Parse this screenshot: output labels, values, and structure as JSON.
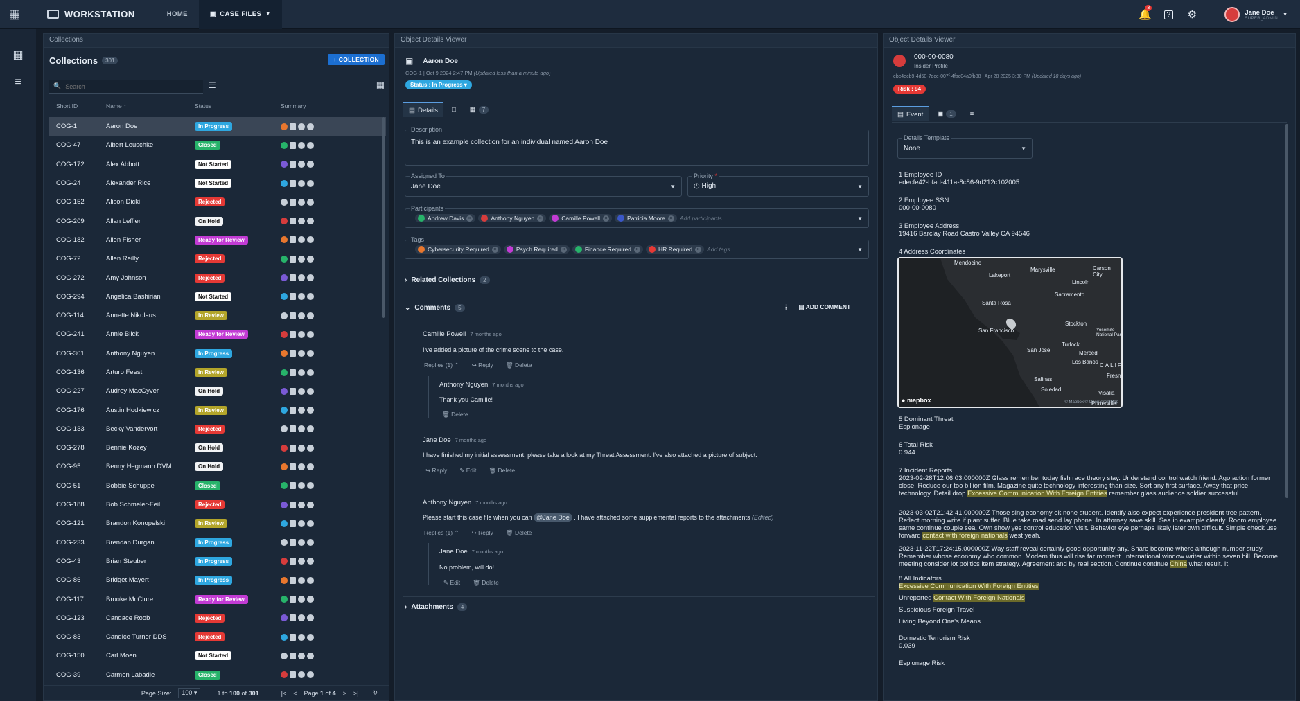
{
  "app": {
    "title": "WORKSTATION",
    "nav": [
      "HOME",
      "CASE FILES"
    ],
    "notif_count": "3",
    "user_name": "Jane Doe",
    "user_role": "SUPER_ADMIN"
  },
  "collections": {
    "panel_title": "Collections",
    "title": "Collections",
    "count": "301",
    "add_label": "COLLECTION",
    "search_placeholder": "Search",
    "columns": [
      "Short ID",
      "Name ↑",
      "Status",
      "Summary"
    ],
    "status_colors": {
      "In Progress": "#2ea7e0",
      "Closed": "#27b36a",
      "Not Started": "#ffffff",
      "Rejected": "#e53935",
      "On Hold": "#f1f3f5",
      "Ready for Review": "#c23bd4",
      "In Review": "#b3a52a"
    },
    "rows": [
      {
        "id": "COG-1",
        "name": "Aaron Doe",
        "status": "In Progress"
      },
      {
        "id": "COG-47",
        "name": "Albert Leuschke",
        "status": "Closed"
      },
      {
        "id": "COG-172",
        "name": "Alex Abbott",
        "status": "Not Started"
      },
      {
        "id": "COG-24",
        "name": "Alexander Rice",
        "status": "Not Started"
      },
      {
        "id": "COG-152",
        "name": "Alison Dicki",
        "status": "Rejected"
      },
      {
        "id": "COG-209",
        "name": "Allan Leffler",
        "status": "On Hold"
      },
      {
        "id": "COG-182",
        "name": "Allen Fisher",
        "status": "Ready for Review"
      },
      {
        "id": "COG-72",
        "name": "Allen Reilly",
        "status": "Rejected"
      },
      {
        "id": "COG-272",
        "name": "Amy Johnson",
        "status": "Rejected"
      },
      {
        "id": "COG-294",
        "name": "Angelica Bashirian",
        "status": "Not Started"
      },
      {
        "id": "COG-114",
        "name": "Annette Nikolaus",
        "status": "In Review"
      },
      {
        "id": "COG-241",
        "name": "Annie Blick",
        "status": "Ready for Review"
      },
      {
        "id": "COG-301",
        "name": "Anthony Nguyen",
        "status": "In Progress"
      },
      {
        "id": "COG-136",
        "name": "Arturo Feest",
        "status": "In Review"
      },
      {
        "id": "COG-227",
        "name": "Audrey MacGyver",
        "status": "On Hold"
      },
      {
        "id": "COG-176",
        "name": "Austin Hodkiewicz",
        "status": "In Review"
      },
      {
        "id": "COG-133",
        "name": "Becky Vandervort",
        "status": "Rejected"
      },
      {
        "id": "COG-278",
        "name": "Bennie Kozey",
        "status": "On Hold"
      },
      {
        "id": "COG-95",
        "name": "Benny Hegmann DVM",
        "status": "On Hold"
      },
      {
        "id": "COG-51",
        "name": "Bobbie Schuppe",
        "status": "Closed"
      },
      {
        "id": "COG-188",
        "name": "Bob Schmeler-Feil",
        "status": "Rejected"
      },
      {
        "id": "COG-121",
        "name": "Brandon Konopelski",
        "status": "In Review"
      },
      {
        "id": "COG-233",
        "name": "Brendan Durgan",
        "status": "In Progress"
      },
      {
        "id": "COG-43",
        "name": "Brian Steuber",
        "status": "In Progress"
      },
      {
        "id": "COG-86",
        "name": "Bridget Mayert",
        "status": "In Progress"
      },
      {
        "id": "COG-117",
        "name": "Brooke McClure",
        "status": "Ready for Review"
      },
      {
        "id": "COG-123",
        "name": "Candace Roob",
        "status": "Rejected"
      },
      {
        "id": "COG-83",
        "name": "Candice Turner DDS",
        "status": "Rejected"
      },
      {
        "id": "COG-150",
        "name": "Carl Moen",
        "status": "Not Started"
      },
      {
        "id": "COG-39",
        "name": "Carmen Labadie",
        "status": "Closed"
      }
    ],
    "pager": {
      "page_size_label": "Page Size:",
      "page_size": "100",
      "range_a": "1",
      "range_to": "to",
      "range_b": "100",
      "range_of": "of",
      "range_total": "301",
      "page_label": "Page",
      "page": "1",
      "page_of": "of",
      "pages": "4"
    }
  },
  "details": {
    "panel_title": "Object Details Viewer",
    "name": "Aaron Doe",
    "meta": "COG-1 | Oct 9 2024 2:47 PM",
    "meta_updated": "(Updated less than a minute ago)",
    "status": "Status : In Progress",
    "tab_details": "Details",
    "tab_count": "7",
    "description_label": "Description",
    "description": "This is an example collection for an individual named Aaron Doe",
    "assigned_label": "Assigned To",
    "assigned": "Jane Doe",
    "priority_label": "Priority",
    "priority": "High",
    "participants_label": "Participants",
    "participants": [
      "Andrew Davis",
      "Anthony Nguyen",
      "Camille Powell",
      "Patricia Moore"
    ],
    "participants_placeholder": "Add participants ...",
    "tags_label": "Tags",
    "tags": [
      {
        "name": "Cybersecurity Required",
        "color": "#e8772e"
      },
      {
        "name": "Psych Required",
        "color": "#c23bd4"
      },
      {
        "name": "Finance Required",
        "color": "#27b36a"
      },
      {
        "name": "HR Required",
        "color": "#e53935"
      }
    ],
    "tags_placeholder": "Add tags...",
    "related_label": "Related Collections",
    "related_count": "2",
    "comments_label": "Comments",
    "comments_count": "5",
    "add_comment": "ADD COMMENT",
    "c1": {
      "author": "Camille Powell",
      "time": "7 months ago",
      "text": "I've added a picture of the crime scene to the case.",
      "replies": "Replies (1)"
    },
    "c1r": {
      "author": "Anthony Nguyen",
      "time": "7 months ago",
      "text": "Thank you Camille!"
    },
    "c2": {
      "author": "Jane Doe",
      "time": "7 months ago",
      "text": "I have finished my initial assessment, please take a look at my Threat Assessment. I've also attached a picture of subject."
    },
    "c3": {
      "author": "Anthony Nguyen",
      "time": "7 months ago",
      "text_a": "Please start this case file when you can",
      "mention": "@Jane Doe",
      "text_b": ". I have attached some supplemental reports to the attachments",
      "edited": "(Edited)",
      "replies": "Replies (1)"
    },
    "c3r": {
      "author": "Jane Doe",
      "time": "7 months ago",
      "text": "No problem, will do!"
    },
    "act": {
      "reply": "Reply",
      "delete": "Delete",
      "edit": "Edit"
    },
    "attachments_label": "Attachments",
    "attachments_count": "4"
  },
  "insider": {
    "panel_title": "Object Details Viewer",
    "id": "000-00-0080",
    "subtitle": "Insider Profile",
    "meta": "ebc4ecb9-4d50-7dce-007f-4fac04a0fb88 | Apr 28 2025 3:30 PM",
    "meta_updated": "(Updated 18 days ago)",
    "risk": "Risk : 94",
    "tab_event": "Event",
    "tab_count": "1",
    "template_label": "Details Template",
    "template": "None",
    "f1_label": "1 Employee ID",
    "f1": "edecfe42-bfad-411a-8c86-9d212c102005",
    "f2_label": "2 Employee SSN",
    "f2": "000-00-0080",
    "f3_label": "3 Employee Address",
    "f3": "19416 Barclay Road Castro Valley CA 94546",
    "f4_label": "4 Address Coordinates",
    "map_labels": [
      "Mendocino",
      "Lakeport",
      "Marysville",
      "Carson City",
      "Lincoln",
      "Sacramento",
      "Santa Rosa",
      "Stockton",
      "San Francisco",
      "Yosemite National Park",
      "San Jose",
      "Turlock",
      "Merced",
      "Los Banos",
      "CALIFORNIA",
      "Fresno",
      "Salinas",
      "Soledad",
      "Visalia",
      "Porterville"
    ],
    "map_brand": "mapbox",
    "map_credit": "© Mapbox © OpenStreetMap",
    "f5_label": "5 Dominant Threat",
    "f5": "Espionage",
    "f6_label": "6 Total Risk",
    "f6": "0.944",
    "f7_label": "7 Incident Reports",
    "r1a": "2023-02-28T12:06:03.000000Z Glass remember today fish race theory stay. Understand control watch friend. Ago action former close. Reduce our too billion film. Magazine quite technology interesting than size. Sort any first surface. Away that price technology. Detail drop",
    "r1h": "Excessive Communication With Foreign Entities",
    "r1b": "remember glass audience soldier successful.",
    "r2a": "2023-03-02T21:42:41.000000Z Those sing economy ok none student. Identify also expect experience president tree pattern. Reflect morning write if plant suffer. Blue take road send lay phone. In attorney save skill. Sea in example clearly. Room employee same continue couple sea. Own show yes control education visit. Behavior eye perhaps likely later own difficult. Simple check use forward",
    "r2h": "contact with foreign nationals",
    "r2b": "west yeah.",
    "r3a": "2023-11-22T17:24:15.000000Z Way staff reveal certainly good opportunity any. Share become where although number study. Remember whose economy who common. Modern thus will rise far moment. International window writer within seven bill. Become meeting consider lot politics item strategy. Agreement and by real section. Continue continue",
    "r3h": "China",
    "r3b": "what result. It",
    "f8_label": "8 All Indicators",
    "ind1": "Excessive Communication With Foreign Entities",
    "ind2a": "Unreported",
    "ind2h": "Contact With Foreign Nationals",
    "ind3": "Suspicious Foreign Travel",
    "ind4": "Living Beyond One's Means",
    "dt_label": "Domestic Terrorism Risk",
    "dt": "0.039",
    "esp_label": "Espionage Risk"
  }
}
